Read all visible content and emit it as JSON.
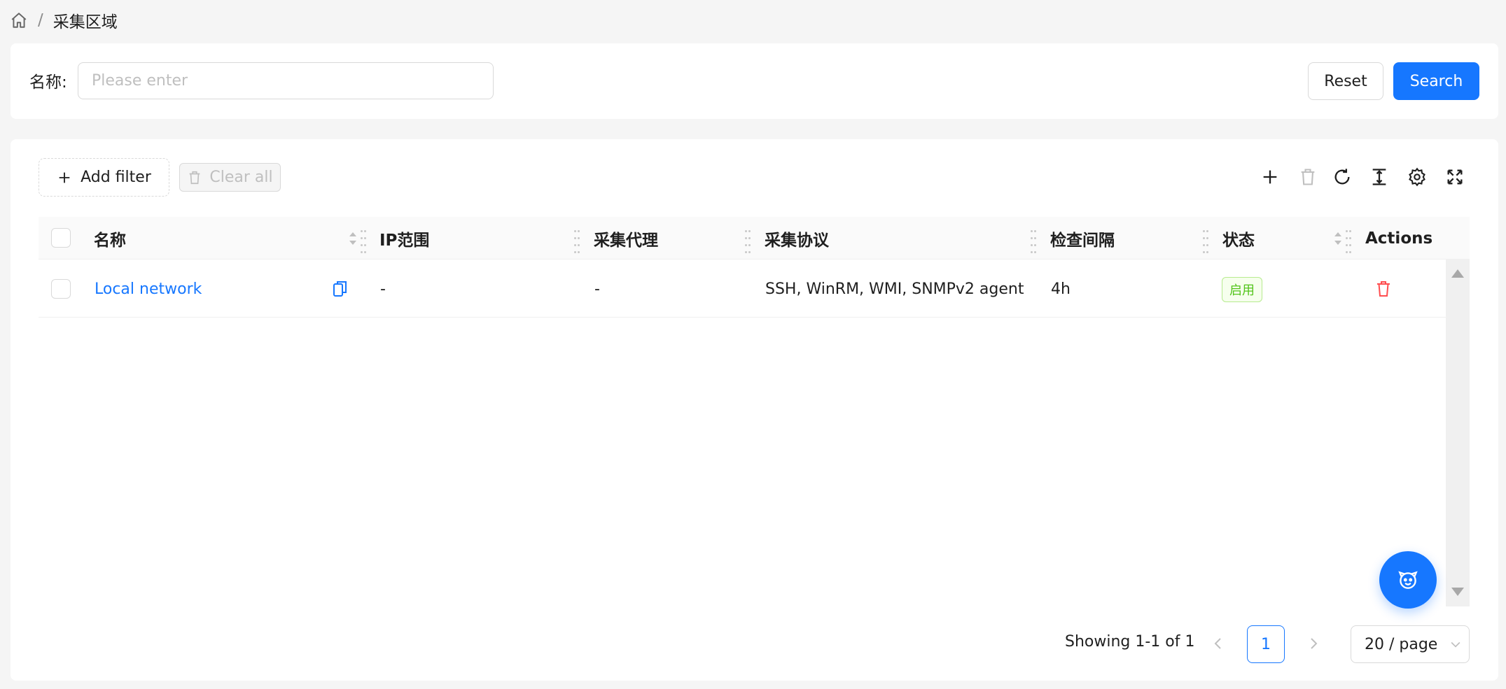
{
  "breadcrumb": {
    "separator": "/",
    "current": "采集区域"
  },
  "search": {
    "name_label": "名称:",
    "name_placeholder": "Please enter",
    "name_value": "",
    "reset_label": "Reset",
    "search_label": "Search"
  },
  "table_toolbar": {
    "add_filter_label": "Add filter",
    "clear_all_label": "Clear all",
    "icons": [
      "plus-icon",
      "trash-icon",
      "refresh-icon",
      "density-icon",
      "gear-icon",
      "fullscreen-icon"
    ]
  },
  "table": {
    "columns": [
      "名称",
      "IP范围",
      "采集代理",
      "采集协议",
      "检查间隔",
      "状态",
      "Actions"
    ],
    "rows": [
      {
        "name": "Local network",
        "ip_range": "-",
        "agent": "-",
        "protocols": "SSH, WinRM, WMI, SNMPv2 agent",
        "interval": "4h",
        "status": "启用"
      }
    ]
  },
  "pagination": {
    "total_text": "Showing 1-1 of 1",
    "current_page": "1",
    "page_size": "20 / page"
  },
  "colors": {
    "primary": "#1677ff",
    "success": "#52c41a",
    "danger": "#ff4d4f"
  }
}
